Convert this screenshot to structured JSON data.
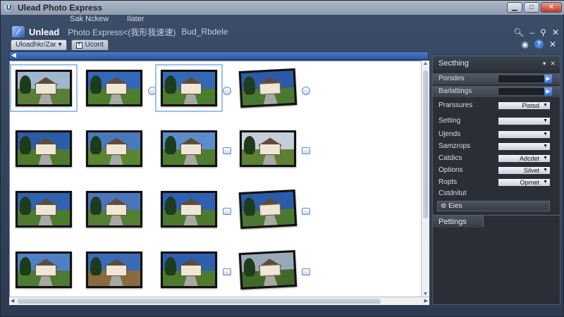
{
  "window": {
    "title": "Ulead Photo Express",
    "controls": {
      "minimize": "▁",
      "maximize": "□",
      "close": "✕"
    }
  },
  "menu": {
    "items": [
      "Sak Nckew",
      "Ilater"
    ]
  },
  "brand": {
    "name": "Unlead",
    "product": "Photo Express<(我形我速速)",
    "subtitle": "Bud_Rbdele"
  },
  "tabs": [
    {
      "label": "Uloadhkr/Zar ▾"
    },
    {
      "label": "Ucont"
    }
  ],
  "thumbnails": {
    "grid": [
      [
        {
          "sky": "#9fb6cf",
          "grass": "#5a7e3a",
          "frame": true
        },
        {
          "sky": "#3367b8",
          "grass": "#4e7d2e",
          "badge": "round"
        },
        {
          "sky": "#3368b4",
          "grass": "#4c7c2f",
          "frame": true,
          "badge": "round"
        },
        {
          "sky": "#2c5aa8",
          "grass": "#4a7830",
          "badge": "round",
          "tilt": true
        }
      ],
      [
        {
          "sky": "#2c5ca8",
          "grass": "#4d7b2d"
        },
        {
          "sky": "#4a78bd",
          "grass": "#5a8532"
        },
        {
          "sky": "#5b8ccc",
          "grass": "#4e7d30",
          "badge": "square"
        },
        {
          "sky": "#c6cfd9",
          "grass": "#5d8034",
          "badge": "square"
        }
      ],
      [
        {
          "sky": "#2f62b0",
          "grass": "#4c7b2e"
        },
        {
          "sky": "#4875bb",
          "grass": "#557f33"
        },
        {
          "sky": "#2d61b2",
          "grass": "#4b7a2f",
          "badge": "square"
        },
        {
          "sky": "#2c5ca9",
          "grass": "#4a7830",
          "badge": "square",
          "tilt": true
        }
      ],
      [
        {
          "sky": "#4e80c4",
          "grass": "#4d7a31"
        },
        {
          "sky": "#3a6bb6",
          "grass": "#8a6a3e"
        },
        {
          "sky": "#2d5fae",
          "grass": "#4c7a2e",
          "badge": "square"
        },
        {
          "sky": "#9aa9b9",
          "grass": "#3f6a2a",
          "badge": "square",
          "tilt": true
        }
      ]
    ]
  },
  "panel": {
    "header": "Secthing",
    "header_tools": [
      "▾",
      "✕"
    ],
    "rows": [
      {
        "label": "Porsdes",
        "kind": "bar"
      },
      {
        "label": "Barlattings",
        "kind": "bar"
      },
      {
        "label": "Prarssures",
        "kind": "dropdown",
        "value": "Pistsd"
      },
      {
        "label": "Setting",
        "kind": "dropdown",
        "value": ""
      },
      {
        "label": "Ujends",
        "kind": "dropdown",
        "value": ""
      },
      {
        "label": "Samzrops",
        "kind": "dropdown",
        "value": ""
      },
      {
        "label": "Catdics",
        "kind": "dropdown",
        "value": "Adcdet"
      },
      {
        "label": "Options",
        "kind": "dropdown",
        "value": "Silvet"
      },
      {
        "label": "Ropts",
        "kind": "dropdown",
        "value": "Oprnet"
      },
      {
        "label": "Cstdnitut",
        "kind": "label"
      }
    ],
    "search_label": "Eies",
    "footer_label": "Pettings"
  },
  "icons": {
    "app": "app-logo-icon",
    "zoom": "magnifier-icon",
    "pin": "pin-icon",
    "help": "help-icon"
  },
  "colors": {
    "accent": "#2f6bd2",
    "panel_bg": "#2a2f37",
    "window_bg": "#2c3b52"
  }
}
